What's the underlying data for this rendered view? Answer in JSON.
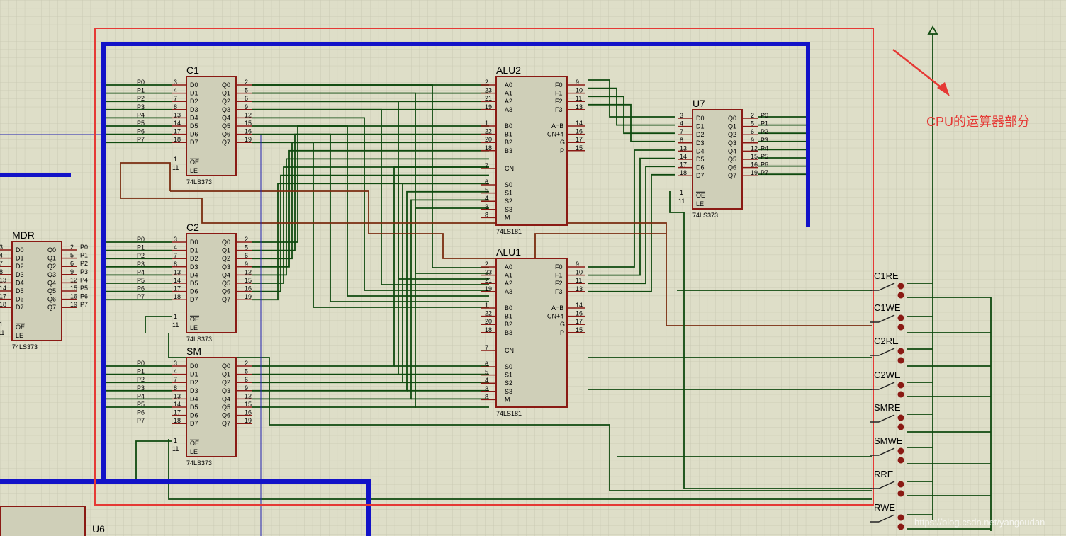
{
  "chips": {
    "c1": {
      "title": "C1",
      "part": "74LS373"
    },
    "c2": {
      "title": "C2",
      "part": "74LS373"
    },
    "sm": {
      "title": "SM",
      "part": "74LS373"
    },
    "mdr": {
      "title": "MDR",
      "part": "74LS373"
    },
    "u7": {
      "title": "U7",
      "part": "74LS373"
    },
    "alu2": {
      "title": "ALU2",
      "part": "74LS181"
    },
    "alu1": {
      "title": "ALU1",
      "part": "74LS181"
    },
    "u6": {
      "title": "U6"
    }
  },
  "pins373": {
    "inputs": [
      "D0",
      "D1",
      "D2",
      "D3",
      "D4",
      "D5",
      "D6",
      "D7"
    ],
    "outputs": [
      "Q0",
      "Q1",
      "Q2",
      "Q3",
      "Q4",
      "Q5",
      "Q6",
      "Q7"
    ],
    "in_nums": [
      "3",
      "4",
      "7",
      "8",
      "13",
      "14",
      "17",
      "18"
    ],
    "out_nums": [
      "2",
      "5",
      "6",
      "9",
      "12",
      "15",
      "16",
      "19"
    ],
    "oe": "OE",
    "le": "LE",
    "oe_num": "1",
    "le_num": "11"
  },
  "nets": [
    "P0",
    "P1",
    "P2",
    "P3",
    "P4",
    "P5",
    "P6",
    "P7"
  ],
  "pins181": {
    "a": [
      "A0",
      "A1",
      "A2",
      "A3"
    ],
    "a_nums": [
      "2",
      "23",
      "21",
      "19"
    ],
    "b": [
      "B0",
      "B1",
      "B2",
      "B3"
    ],
    "b_nums": [
      "1",
      "22",
      "20",
      "18"
    ],
    "cn": "CN",
    "cn_num": "7",
    "s": [
      "S0",
      "S1",
      "S2",
      "S3",
      "M"
    ],
    "s_nums": [
      "6",
      "5",
      "4",
      "3",
      "8"
    ],
    "f": [
      "F0",
      "F1",
      "F2",
      "F3"
    ],
    "f_nums": [
      "9",
      "10",
      "11",
      "13"
    ],
    "r": [
      "A=B",
      "CN+4",
      "G",
      "P"
    ],
    "r_nums": [
      "14",
      "16",
      "17",
      "15"
    ]
  },
  "switches": [
    "C1RE",
    "C1WE",
    "C2RE",
    "C2WE",
    "SMRE",
    "SMWE",
    "RRE",
    "RWE"
  ],
  "annotation": "CPU的运算器部分",
  "watermark": "https://blog.csdn.net/yangoudan",
  "colors": {
    "bus": "#1212c8",
    "wire": "#0f4a0f",
    "chip_border": "#8a1a14",
    "highlight": "#e53935",
    "background": "#dedec8"
  }
}
